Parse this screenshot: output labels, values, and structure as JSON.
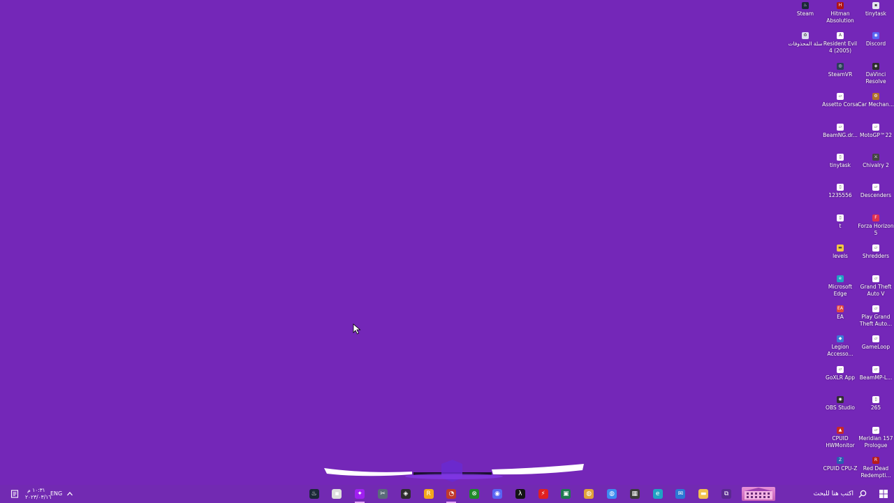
{
  "desktop": {
    "background_color": "#7427b8",
    "icons": [
      {
        "label": "Steam",
        "icon": "steam-icon",
        "color": "#1b2838",
        "glyph": "♨"
      },
      {
        "label": "Hitman Absolution",
        "icon": "hitman-icon",
        "color": "#b01515",
        "glyph": "H"
      },
      {
        "label": "tinytask",
        "icon": "tinytask-icon",
        "color": "#e6e6f0",
        "glyph": "▪"
      },
      {
        "label": "سلة المحذوفات",
        "icon": "recycle-bin-icon",
        "color": "#dcdcf0",
        "glyph": "♻"
      },
      {
        "label": "Resident Evil 4 (2005)",
        "icon": "resident-evil-icon",
        "color": "#ffffff",
        "glyph": "A"
      },
      {
        "label": "Discord",
        "icon": "discord-icon",
        "color": "#5865f2",
        "glyph": "◉"
      },
      {
        "label": "SteamVR",
        "icon": "steamvr-icon",
        "color": "#2a3f5a",
        "glyph": "◎"
      },
      {
        "label": "DaVinci Resolve",
        "icon": "davinci-icon",
        "color": "#2d2d2d",
        "glyph": "◈"
      },
      {
        "label": "Assetto Corsa",
        "icon": "assetto-corsa-icon",
        "color": "#ffffff",
        "glyph": "▱"
      },
      {
        "label": "Car Mechan...",
        "icon": "car-mechanic-icon",
        "color": "#b0702a",
        "glyph": "⚙"
      },
      {
        "label": "BeamNG.dr...",
        "icon": "beamng-icon",
        "color": "#ffffff",
        "glyph": "▱"
      },
      {
        "label": "MotoGP™22",
        "icon": "motogp-icon",
        "color": "#ffffff",
        "glyph": "▱"
      },
      {
        "label": "tinytask",
        "icon": "tinytask-icon",
        "color": "#ffffff",
        "glyph": "▯"
      },
      {
        "label": "Chivalry 2",
        "icon": "chivalry-icon",
        "color": "#444444",
        "glyph": "⚔"
      },
      {
        "label": "1235556",
        "icon": "file-icon",
        "color": "#ffffff",
        "glyph": "▯"
      },
      {
        "label": "Descenders",
        "icon": "descenders-icon",
        "color": "#ffffff",
        "glyph": "▱"
      },
      {
        "label": "t",
        "icon": "file-icon",
        "color": "#ffffff",
        "glyph": "▯"
      },
      {
        "label": "Forza Horizon 5",
        "icon": "forza-icon",
        "color": "#e03050",
        "glyph": "F"
      },
      {
        "label": "levels",
        "icon": "folder-icon",
        "color": "#f5c842",
        "glyph": "▬"
      },
      {
        "label": "Shredders",
        "icon": "shredders-icon",
        "color": "#ffffff",
        "glyph": "▱"
      },
      {
        "label": "Microsoft Edge",
        "icon": "edge-icon",
        "color": "#1fa3c4",
        "glyph": "e"
      },
      {
        "label": "Grand Theft Auto V",
        "icon": "gta-icon",
        "color": "#ffffff",
        "glyph": "▱"
      },
      {
        "label": "EA",
        "icon": "ea-icon",
        "color": "#e2483d",
        "glyph": "EA"
      },
      {
        "label": "Play Grand Theft Auto...",
        "icon": "gta-play-icon",
        "color": "#ffffff",
        "glyph": "▱"
      },
      {
        "label": "Legion Accesso...",
        "icon": "legion-icon",
        "color": "#3a7bd5",
        "glyph": "◆"
      },
      {
        "label": "GameLoop",
        "icon": "gameloop-icon",
        "color": "#ffffff",
        "glyph": "▱"
      },
      {
        "label": "GoXLR App",
        "icon": "goxlr-icon",
        "color": "#ffffff",
        "glyph": "▱"
      },
      {
        "label": "BeamMP-L...",
        "icon": "beammp-icon",
        "color": "#ffffff",
        "glyph": "▱"
      },
      {
        "label": "OBS Studio",
        "icon": "obs-icon",
        "color": "#302e31",
        "glyph": "◉"
      },
      {
        "label": "265",
        "icon": "file-icon",
        "color": "#ffffff",
        "glyph": "▯"
      },
      {
        "label": "CPUID HWMonitor",
        "icon": "hwmonitor-icon",
        "color": "#c62828",
        "glyph": "▲"
      },
      {
        "label": "Meridian 157 Prologue",
        "icon": "meridian-icon",
        "color": "#ffffff",
        "glyph": "▱"
      },
      {
        "label": "CPUID CPU-Z",
        "icon": "cpuz-icon",
        "color": "#2a5db0",
        "glyph": "Z"
      },
      {
        "label": "Red Dead Redempti...",
        "icon": "red-dead-icon",
        "color": "#b71c1c",
        "glyph": "R"
      }
    ]
  },
  "taskbar": {
    "search_placeholder": "اكتب هنا للبحث",
    "apps": [
      {
        "icon": "task-view-icon",
        "color": "#5a2990",
        "glyph": "⧉"
      },
      {
        "icon": "file-explorer-icon",
        "color": "#f2c14e",
        "glyph": "▬"
      },
      {
        "icon": "outlook-icon",
        "color": "#2b78d4",
        "glyph": "✉"
      },
      {
        "icon": "edge-icon",
        "color": "#1fa3c4",
        "glyph": "e"
      },
      {
        "icon": "microsoft-store-icon",
        "color": "#3b3b3b",
        "glyph": "▦"
      },
      {
        "icon": "chrome-icon",
        "color": "#3c8cf0",
        "glyph": "◍"
      },
      {
        "icon": "chrome-icon",
        "color": "#e0a23a",
        "glyph": "◍"
      },
      {
        "icon": "goxlr-icon",
        "color": "#1f7a50",
        "glyph": "▣"
      },
      {
        "icon": "flash-icon",
        "color": "#e02020",
        "glyph": "⚡"
      },
      {
        "icon": "lambda-icon",
        "color": "#141414",
        "glyph": "λ"
      },
      {
        "icon": "discord-icon",
        "color": "#5865f2",
        "glyph": "◉"
      },
      {
        "icon": "xbox-icon",
        "color": "#1f8a2a",
        "glyph": "⊗"
      },
      {
        "icon": "speedometer-icon",
        "color": "#c0392b",
        "glyph": "◔"
      },
      {
        "icon": "rockstar-icon",
        "color": "#f1a81b",
        "glyph": "R"
      },
      {
        "icon": "davinci-icon",
        "color": "#2d2d2d",
        "glyph": "◈"
      },
      {
        "icon": "snipping-tool-icon",
        "color": "#5a6b7a",
        "glyph": "✂"
      },
      {
        "icon": "purple-app-icon",
        "color": "#a020f0",
        "glyph": "✦"
      },
      {
        "icon": "tinytask-icon",
        "color": "#ddd",
        "glyph": "▪"
      },
      {
        "icon": "steam-icon",
        "color": "#1b2838",
        "glyph": "♨"
      }
    ],
    "language": "ENG",
    "time": "١٠:٣١ م",
    "date": "٢٠٢٣/٠٣/١٦"
  }
}
